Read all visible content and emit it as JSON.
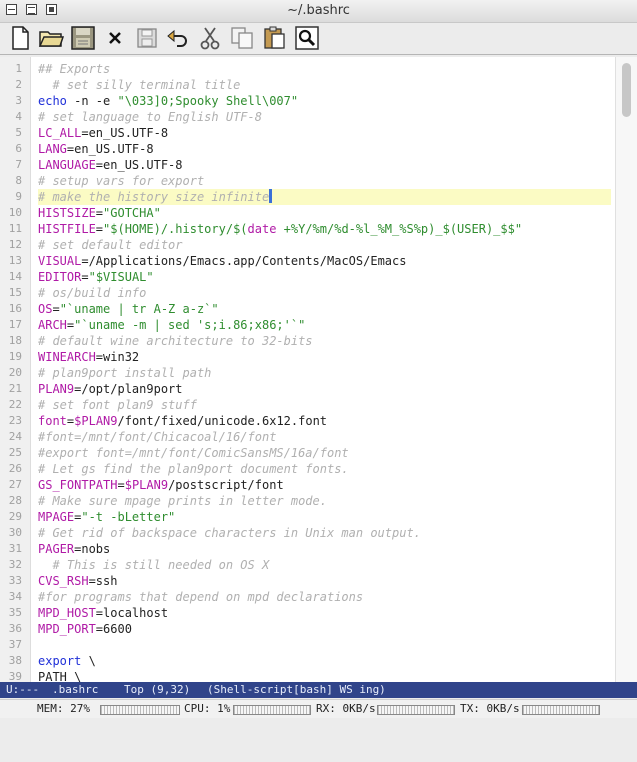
{
  "window": {
    "title": "~/.bashrc"
  },
  "toolbar": {
    "icons": [
      "new-file-icon",
      "open-folder-icon",
      "save-disk-icon",
      "close-x-icon",
      "save-as-icon",
      "undo-icon",
      "cut-icon",
      "copy-icon",
      "paste-icon",
      "search-icon"
    ]
  },
  "editor": {
    "lines": [
      {
        "n": "1",
        "tokens": [
          {
            "t": "## Exports",
            "k": "c"
          }
        ]
      },
      {
        "n": "2",
        "tokens": [
          {
            "t": "  # set silly terminal title",
            "k": "c"
          }
        ]
      },
      {
        "n": "3",
        "tokens": [
          {
            "t": "echo",
            "k": "k"
          },
          {
            "t": " -n -e ",
            "k": "t"
          },
          {
            "t": "\"\\033]0;Spooky Shell\\007\"",
            "k": "s"
          }
        ]
      },
      {
        "n": "4",
        "tokens": [
          {
            "t": "# set language to English UTF-8",
            "k": "c"
          }
        ]
      },
      {
        "n": "5",
        "tokens": [
          {
            "t": "LC_ALL",
            "k": "v"
          },
          {
            "t": "=en_US.UTF-8",
            "k": "t"
          }
        ]
      },
      {
        "n": "6",
        "tokens": [
          {
            "t": "LANG",
            "k": "v"
          },
          {
            "t": "=en_US.UTF-8",
            "k": "t"
          }
        ]
      },
      {
        "n": "7",
        "tokens": [
          {
            "t": "LANGUAGE",
            "k": "v"
          },
          {
            "t": "=en_US.UTF-8",
            "k": "t"
          }
        ]
      },
      {
        "n": "8",
        "tokens": [
          {
            "t": "# setup vars for export",
            "k": "c"
          }
        ]
      },
      {
        "n": "9",
        "current": true,
        "tokens": [
          {
            "t": "# make the history size infinite",
            "k": "c"
          }
        ]
      },
      {
        "n": "10",
        "tokens": [
          {
            "t": "HISTSIZE",
            "k": "v"
          },
          {
            "t": "=",
            "k": "t"
          },
          {
            "t": "\"GOTCHA\"",
            "k": "s"
          }
        ]
      },
      {
        "n": "11",
        "tokens": [
          {
            "t": "HISTFILE",
            "k": "v"
          },
          {
            "t": "=",
            "k": "t"
          },
          {
            "t": "\"$(HOME)/.history/$(",
            "k": "s"
          },
          {
            "t": "date",
            "k": "v"
          },
          {
            "t": " +%Y/%m/%d-%l_%M_%S%p)_$(USER)_$$\"",
            "k": "s"
          }
        ]
      },
      {
        "n": "12",
        "tokens": [
          {
            "t": "# set default editor",
            "k": "c"
          }
        ]
      },
      {
        "n": "13",
        "tokens": [
          {
            "t": "VISUAL",
            "k": "v"
          },
          {
            "t": "=/Applications/Emacs.app/Contents/MacOS/Emacs",
            "k": "t"
          }
        ]
      },
      {
        "n": "14",
        "tokens": [
          {
            "t": "EDITOR",
            "k": "v"
          },
          {
            "t": "=",
            "k": "t"
          },
          {
            "t": "\"$VISUAL\"",
            "k": "s"
          }
        ]
      },
      {
        "n": "15",
        "tokens": [
          {
            "t": "# os/build info",
            "k": "c"
          }
        ]
      },
      {
        "n": "16",
        "tokens": [
          {
            "t": "OS",
            "k": "v"
          },
          {
            "t": "=",
            "k": "t"
          },
          {
            "t": "\"`uname | tr A-Z a-z`\"",
            "k": "s"
          }
        ]
      },
      {
        "n": "17",
        "tokens": [
          {
            "t": "ARCH",
            "k": "v"
          },
          {
            "t": "=",
            "k": "t"
          },
          {
            "t": "\"`uname -m | sed 's;i.86;x86;'`\"",
            "k": "s"
          }
        ]
      },
      {
        "n": "18",
        "tokens": [
          {
            "t": "# default wine architecture to 32-bits",
            "k": "c"
          }
        ]
      },
      {
        "n": "19",
        "tokens": [
          {
            "t": "WINEARCH",
            "k": "v"
          },
          {
            "t": "=win32",
            "k": "t"
          }
        ]
      },
      {
        "n": "20",
        "tokens": [
          {
            "t": "# plan9port install path",
            "k": "c"
          }
        ]
      },
      {
        "n": "21",
        "tokens": [
          {
            "t": "PLAN9",
            "k": "v"
          },
          {
            "t": "=/opt/plan9port",
            "k": "t"
          }
        ]
      },
      {
        "n": "22",
        "tokens": [
          {
            "t": "# set font plan9 stuff",
            "k": "c"
          }
        ]
      },
      {
        "n": "23",
        "tokens": [
          {
            "t": "font",
            "k": "v"
          },
          {
            "t": "=",
            "k": "t"
          },
          {
            "t": "$PLAN9",
            "k": "v"
          },
          {
            "t": "/font/fixed/unicode.6x12.font",
            "k": "t"
          }
        ]
      },
      {
        "n": "24",
        "tokens": [
          {
            "t": "#font=/mnt/font/Chicacoal/16/font",
            "k": "c"
          }
        ]
      },
      {
        "n": "25",
        "tokens": [
          {
            "t": "#export font=/mnt/font/ComicSansMS/16a/font",
            "k": "c"
          }
        ]
      },
      {
        "n": "26",
        "tokens": [
          {
            "t": "# Let gs find the plan9port document fonts.",
            "k": "c"
          }
        ]
      },
      {
        "n": "27",
        "tokens": [
          {
            "t": "GS_FONTPATH",
            "k": "v"
          },
          {
            "t": "=",
            "k": "t"
          },
          {
            "t": "$PLAN9",
            "k": "v"
          },
          {
            "t": "/postscript/font",
            "k": "t"
          }
        ]
      },
      {
        "n": "28",
        "tokens": [
          {
            "t": "# Make sure mpage prints in letter mode.",
            "k": "c"
          }
        ]
      },
      {
        "n": "29",
        "tokens": [
          {
            "t": "MPAGE",
            "k": "v"
          },
          {
            "t": "=",
            "k": "t"
          },
          {
            "t": "\"-t -bLetter\"",
            "k": "s"
          }
        ]
      },
      {
        "n": "30",
        "tokens": [
          {
            "t": "# Get rid of backspace characters in Unix man output.",
            "k": "c"
          }
        ]
      },
      {
        "n": "31",
        "tokens": [
          {
            "t": "PAGER",
            "k": "v"
          },
          {
            "t": "=nobs",
            "k": "t"
          }
        ]
      },
      {
        "n": "32",
        "tokens": [
          {
            "t": "  # This is still needed on OS X",
            "k": "c"
          }
        ]
      },
      {
        "n": "33",
        "tokens": [
          {
            "t": "CVS_RSH",
            "k": "v"
          },
          {
            "t": "=ssh",
            "k": "t"
          }
        ]
      },
      {
        "n": "34",
        "tokens": [
          {
            "t": "#for programs that depend on mpd declarations",
            "k": "c"
          }
        ]
      },
      {
        "n": "35",
        "tokens": [
          {
            "t": "MPD_HOST",
            "k": "v"
          },
          {
            "t": "=localhost",
            "k": "t"
          }
        ]
      },
      {
        "n": "36",
        "tokens": [
          {
            "t": "MPD_PORT",
            "k": "v"
          },
          {
            "t": "=6600",
            "k": "t"
          }
        ]
      },
      {
        "n": "37",
        "tokens": []
      },
      {
        "n": "38",
        "tokens": [
          {
            "t": "export",
            "k": "k"
          },
          {
            "t": " \\",
            "k": "t"
          }
        ]
      },
      {
        "n": "39",
        "tokens": [
          {
            "t": "PATH \\",
            "k": "t"
          }
        ]
      }
    ]
  },
  "modeline": {
    "status": "U:---",
    "file": ".bashrc",
    "position": "Top (9,32)",
    "mode": "(Shell-script[bash] WS ing)"
  },
  "statusbar": {
    "mem": "MEM: 27%",
    "cpu": "CPU: 1%",
    "rx": "RX: 0KB/s",
    "tx": "TX: 0KB/s"
  }
}
